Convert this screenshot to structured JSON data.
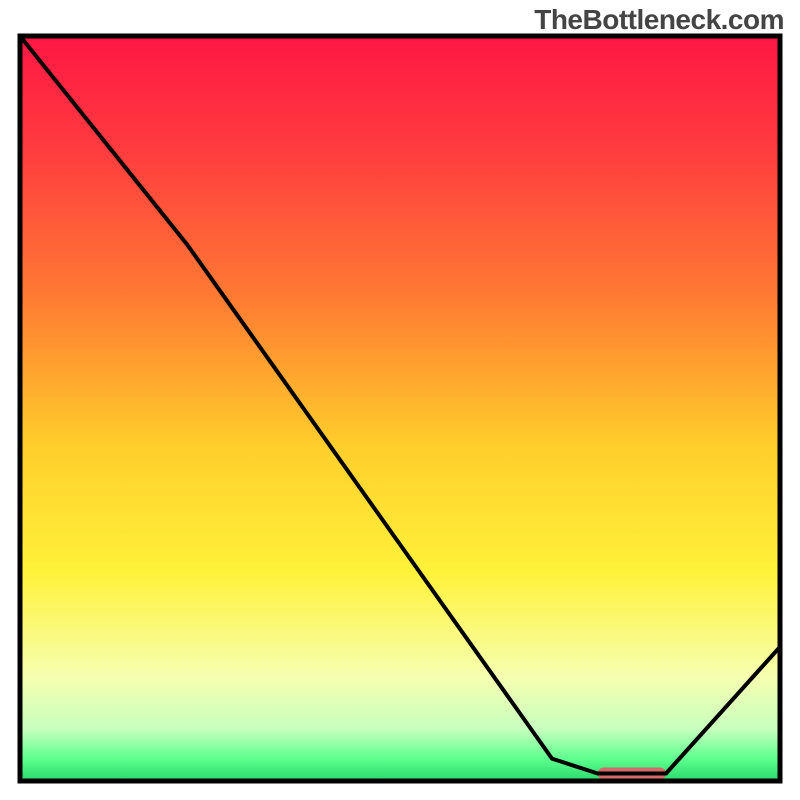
{
  "watermark": "TheBottleneck.com",
  "chart_data": {
    "type": "line",
    "title": "",
    "xlabel": "",
    "ylabel": "",
    "xlim": [
      0,
      100
    ],
    "ylim": [
      0,
      100
    ],
    "series": [
      {
        "name": "curve",
        "x": [
          0,
          22,
          70,
          76,
          85,
          100
        ],
        "y": [
          100,
          72,
          3,
          1,
          1,
          18
        ]
      }
    ],
    "marker": {
      "x_start": 76,
      "x_end": 85,
      "y": 1,
      "color": "#d46a6a"
    },
    "gradient_stops": [
      {
        "offset": 0.0,
        "color": "#ff1744"
      },
      {
        "offset": 0.15,
        "color": "#ff3b3f"
      },
      {
        "offset": 0.35,
        "color": "#ff7a33"
      },
      {
        "offset": 0.55,
        "color": "#ffce2b"
      },
      {
        "offset": 0.72,
        "color": "#fff23a"
      },
      {
        "offset": 0.86,
        "color": "#f6ffb0"
      },
      {
        "offset": 0.93,
        "color": "#c8ffbf"
      },
      {
        "offset": 0.97,
        "color": "#5eff8f"
      },
      {
        "offset": 1.0,
        "color": "#29d96b"
      }
    ],
    "border_color": "#000000",
    "line_color": "#000000"
  }
}
